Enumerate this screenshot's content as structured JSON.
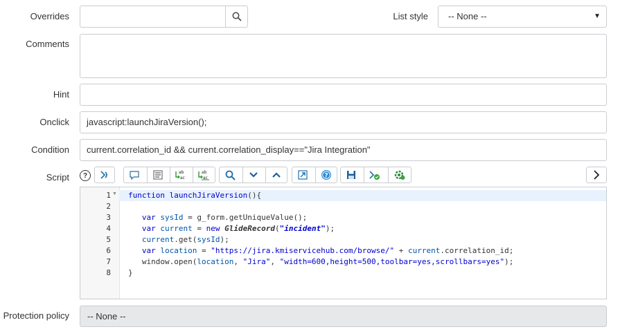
{
  "form": {
    "overrides": {
      "label": "Overrides",
      "value": ""
    },
    "list_style": {
      "label": "List style",
      "value": "-- None --"
    },
    "comments": {
      "label": "Comments",
      "value": ""
    },
    "hint": {
      "label": "Hint",
      "value": ""
    },
    "onclick": {
      "label": "Onclick",
      "value": "javascript:launchJiraVersion();"
    },
    "condition": {
      "label": "Condition",
      "value": "current.correlation_id && current.correlation_display==\"Jira Integration\""
    },
    "script": {
      "label": "Script"
    },
    "protection_policy": {
      "label": "Protection policy",
      "value": "-- None --"
    }
  },
  "toolbar": {
    "help": "?",
    "icons": [
      "format-code-icon",
      "comment-icon",
      "toggle-comment-icon",
      "replace-icon",
      "replace-all-icon",
      "search-icon",
      "fold-down-icon",
      "fold-up-icon",
      "fullscreen-icon",
      "help-icon",
      "save-icon",
      "check-syntax-icon",
      "script-debugger-icon",
      "expand-right-icon"
    ]
  },
  "editor": {
    "line_numbers": [
      "1",
      "2",
      "3",
      "4",
      "5",
      "6",
      "7",
      "8"
    ]
  },
  "colors": {
    "border": "#c9ccd1",
    "readonly_bg": "#e6e8ea",
    "keyword": "#0000cc",
    "active_line": "#e8f2fe"
  }
}
